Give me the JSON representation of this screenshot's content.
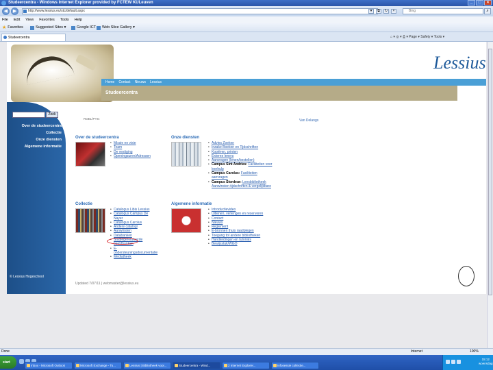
{
  "window": {
    "title": "Studeercentra - Windows Internet Explorer provided by FCTEW KULeuven"
  },
  "address": {
    "url": "http://www.lessius.eu/stc/default.aspx",
    "search_placeholder": "Bing"
  },
  "menu": [
    "File",
    "Edit",
    "View",
    "Favorites",
    "Tools",
    "Help"
  ],
  "favorites": {
    "label": "Favorites",
    "items": [
      "Suggested Sites ▾",
      "Google ICT",
      "Web Slice Gallery ▾"
    ]
  },
  "tab": {
    "label": "Studeercentra"
  },
  "command_bar": "Page ▾  Safety ▾  Tools ▾",
  "site": {
    "logo": "Lessius",
    "nav": [
      "Home",
      "Contact",
      "Nieuws",
      "Lessius"
    ],
    "section_title": "Studeercentra",
    "breadcrumb": "ROEL/PYS:",
    "web_language": "Van Delangs",
    "search_button": "Zoek",
    "sidebar": [
      "Over de studeercentra",
      "Collectie",
      "Onze diensten",
      "Algemene informatie"
    ],
    "copyright": "© Lessius Hogeschool",
    "footer": "Updated 7/07/11 | webmaster@lessius.eu"
  },
  "sections": {
    "over": {
      "title": "Over de studeercentra",
      "links": [
        "Missie en visie",
        "Team",
        "De vestiging",
        "Openingsuren/Adressen"
      ]
    },
    "diensten": {
      "title": "Onze diensten",
      "links": [
        {
          "text": "Advies Zoeken",
          "link": true
        },
        {
          "text": "Inzake Boeken en Tijdschriften",
          "link": true
        },
        {
          "text": "Kopiëren, printen",
          "link": true
        },
        {
          "text": "Externe leners",
          "link": true
        },
        {
          "text": "Aanvragen (lenen/bestellen)",
          "link": true
        },
        {
          "text": "Campus Sint Andries: ",
          "bold": true,
          "more": "Faciliteiten voor",
          "tail": "leerhulp"
        },
        {
          "text": "Campus Carolus: ",
          "bold": true,
          "more": "Faciliteiten",
          "tail": "aanvragen"
        },
        {
          "text": "Campus Stordeur: ",
          "bold": true,
          "more": "Leesbibliotheek",
          "tail": "Aanwinsten tijdschriften & vergelijkbare"
        }
      ]
    },
    "collectie": {
      "title": "Collectie",
      "links": [
        "Catalogus Libis Lessius",
        "Catalogus Campus De Nayer",
        "Catalogus Carolus",
        "Andere catalogi",
        "Aanwinsten",
        "Databanken",
        "Studiegerelateerde beeldbanken",
        "E-ondersteuningsdocumentatie",
        "Mediatheek"
      ]
    },
    "algemeen": {
      "title": "Algemene informatie",
      "links": [
        "Introductievideo",
        "Uitlenen, verlengen en reserveren",
        "Contact",
        "Nieuws",
        "Reglement",
        "E-bronnen thuis raadplegen",
        "Toegang tot andere bibliotheken",
        "Handleidingen en tutorials",
        "Bewijsstuk/WGO"
      ]
    }
  },
  "statusbar": {
    "left": "Done",
    "zone": "Internet",
    "zoom": "100%"
  },
  "taskbar": {
    "start": "start",
    "tasks": [
      "Inbox - Microsoft Outlook",
      "Microsoft Exchange - To...",
      "Lessius | Bibliotheek voor...",
      "Studeercentra - Wind...",
      "2 Internet Explorer...",
      "Infosessie collectie..."
    ],
    "time": "15:12",
    "day": "woensdag"
  }
}
